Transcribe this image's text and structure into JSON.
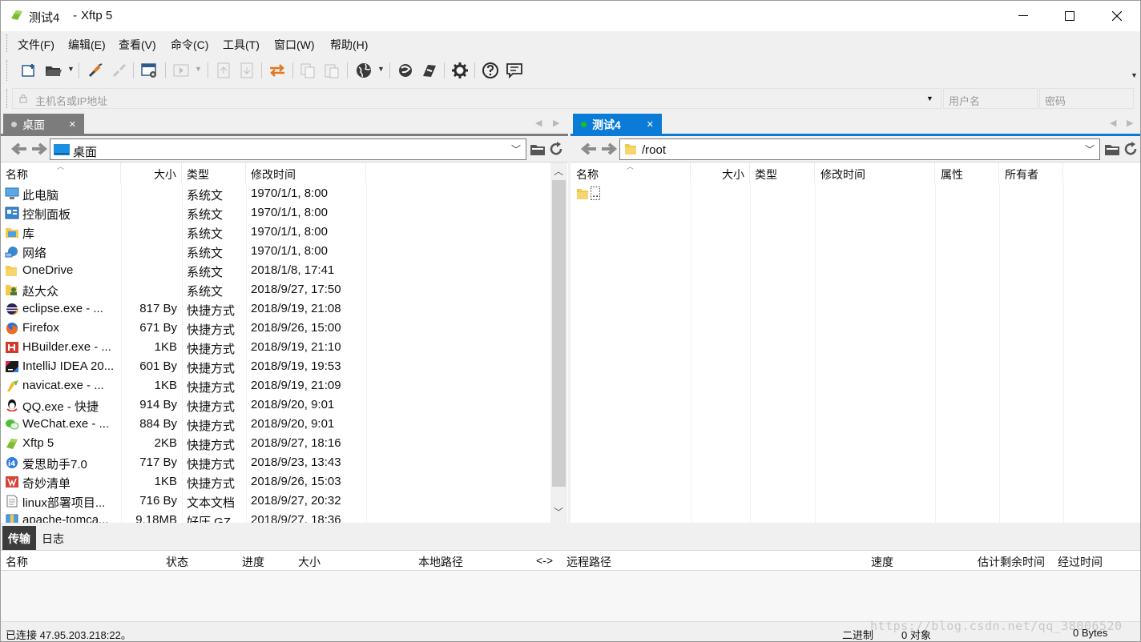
{
  "window": {
    "session": "测试4",
    "separator": "-",
    "app": "Xftp 5"
  },
  "menu": [
    "文件(F)",
    "编辑(E)",
    "查看(V)",
    "命令(C)",
    "工具(T)",
    "窗口(W)",
    "帮助(H)"
  ],
  "address": {
    "host_placeholder": "主机名或IP地址",
    "user_placeholder": "用户名",
    "password_placeholder": "密码"
  },
  "left": {
    "tab_label": "桌面",
    "path": "桌面",
    "columns": [
      "名称",
      "大小",
      "类型",
      "修改时间"
    ],
    "rows": [
      {
        "name": "此电脑",
        "size": "",
        "type": "系统文",
        "modified": "1970/1/1, 8:00",
        "icon": "computer-icon"
      },
      {
        "name": "控制面板",
        "size": "",
        "type": "系统文",
        "modified": "1970/1/1, 8:00",
        "icon": "control-panel-icon"
      },
      {
        "name": "库",
        "size": "",
        "type": "系统文",
        "modified": "1970/1/1, 8:00",
        "icon": "library-icon"
      },
      {
        "name": "网络",
        "size": "",
        "type": "系统文",
        "modified": "1970/1/1, 8:00",
        "icon": "network-icon"
      },
      {
        "name": "OneDrive",
        "size": "",
        "type": "系统文",
        "modified": "2018/1/8, 17:41",
        "icon": "folder-icon"
      },
      {
        "name": "赵大众",
        "size": "",
        "type": "系统文",
        "modified": "2018/9/27, 17:50",
        "icon": "user-folder-icon"
      },
      {
        "name": "eclipse.exe - ...",
        "size": "817 By",
        "type": "快捷方式",
        "modified": "2018/9/19, 21:08",
        "icon": "eclipse-icon"
      },
      {
        "name": "Firefox",
        "size": "671 By",
        "type": "快捷方式",
        "modified": "2018/9/26, 15:00",
        "icon": "firefox-icon"
      },
      {
        "name": "HBuilder.exe - ...",
        "size": "1KB",
        "type": "快捷方式",
        "modified": "2018/9/19, 21:10",
        "icon": "hbuilder-icon"
      },
      {
        "name": "IntelliJ IDEA 20...",
        "size": "601 By",
        "type": "快捷方式",
        "modified": "2018/9/19, 19:53",
        "icon": "intellij-icon"
      },
      {
        "name": "navicat.exe - ...",
        "size": "1KB",
        "type": "快捷方式",
        "modified": "2018/9/19, 21:09",
        "icon": "navicat-icon"
      },
      {
        "name": "QQ.exe - 快捷",
        "size": "914 By",
        "type": "快捷方式",
        "modified": "2018/9/20, 9:01",
        "icon": "qq-icon"
      },
      {
        "name": "WeChat.exe - ...",
        "size": "884 By",
        "type": "快捷方式",
        "modified": "2018/9/20, 9:01",
        "icon": "wechat-icon"
      },
      {
        "name": "Xftp 5",
        "size": "2KB",
        "type": "快捷方式",
        "modified": "2018/9/27, 18:16",
        "icon": "xftp-icon"
      },
      {
        "name": "爱思助手7.0",
        "size": "717 By",
        "type": "快捷方式",
        "modified": "2018/9/23, 13:43",
        "icon": "i4-icon"
      },
      {
        "name": "奇妙清单",
        "size": "1KB",
        "type": "快捷方式",
        "modified": "2018/9/26, 15:03",
        "icon": "wunderlist-icon"
      },
      {
        "name": "linux部署项目...",
        "size": "716 By",
        "type": "文本文档",
        "modified": "2018/9/27, 20:32",
        "icon": "text-file-icon"
      },
      {
        "name": "apache-tomca...",
        "size": "9.18MB",
        "type": "好压 GZ...",
        "modified": "2018/9/27, 18:36",
        "icon": "archive-icon"
      }
    ]
  },
  "right": {
    "tab_label": "测试4",
    "path": "/root",
    "columns": [
      "名称",
      "大小",
      "类型",
      "修改时间",
      "属性",
      "所有者"
    ],
    "rows": [
      {
        "name": "..",
        "icon": "folder-icon"
      }
    ]
  },
  "transfer": {
    "tabs": [
      "传输",
      "日志"
    ],
    "columns": [
      "名称",
      "状态",
      "进度",
      "大小",
      "本地路径",
      "<->",
      "远程路径",
      "速度",
      "估计剩余时间",
      "经过时间"
    ]
  },
  "status": {
    "connection": "已连接 47.95.203.218:22。",
    "mode": "二进制",
    "objects": "0 对象",
    "bytes": "0 Bytes"
  },
  "watermark": "https://blog.csdn.net/qq_38006520",
  "colors": {
    "accent_blue": "#0a7bd6",
    "tab_inactive": "#7c7c7c",
    "connected_dot": "#16c316"
  }
}
